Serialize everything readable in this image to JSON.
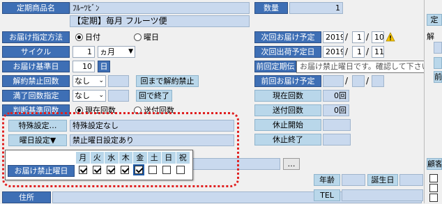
{
  "product": {
    "label": "定期商品名",
    "name_kana": "ﾌﾙｰﾂﾋﾞﾝ",
    "name": "【定期】毎月 フルーツ便"
  },
  "quantity": {
    "label": "数量",
    "value": "1"
  },
  "delivery_method": {
    "label": "お届け指定方法",
    "options": [
      "日付",
      "曜日"
    ],
    "selected": "日付"
  },
  "cycle": {
    "label": "サイクル",
    "value": "1",
    "unit": "ヵ月"
  },
  "base_day": {
    "label": "お届け基準日",
    "value": "10",
    "unit": "日"
  },
  "cancel_ban_count": {
    "label": "解約禁止回数",
    "select": "なし",
    "button": "回まで解約禁止"
  },
  "completion_count": {
    "label": "満了回数指定",
    "select": "なし",
    "button": "回で終了"
  },
  "judge_basis": {
    "label": "判断基準回数",
    "options": [
      "現在回数",
      "送付回数"
    ],
    "selected": "現在回数"
  },
  "special_settings": {
    "button": "特殊設定…",
    "value": "特殊設定なし"
  },
  "weekday_settings": {
    "button": "曜日設定▼",
    "value": "禁止曜日設定あり"
  },
  "forbidden_weekdays": {
    "label": "お届け禁止曜日",
    "days": [
      "月",
      "火",
      "水",
      "木",
      "金",
      "土",
      "日",
      "祝"
    ],
    "checked": [
      true,
      true,
      true,
      true,
      true,
      false,
      false,
      false
    ]
  },
  "next_delivery": {
    "label": "次回お届け予定",
    "year": "2019",
    "month": "1",
    "day": "10"
  },
  "next_shipping": {
    "label": "次回出荷予定日",
    "year": "2019",
    "month": "1",
    "day": "11"
  },
  "prev_regular": {
    "label": "前回定期伝"
  },
  "prev_delivery": {
    "label": "前回お届け予定"
  },
  "tooltip": "お届け禁止曜日です。確認して下さい。",
  "current_count": {
    "label": "現在回数",
    "value": "0回"
  },
  "sent_count": {
    "label": "送付回数",
    "value": "0回"
  },
  "pause_start": {
    "label": "休止開始"
  },
  "pause_end": {
    "label": "休止終了"
  },
  "customer": {
    "age_label": "年齢",
    "birth_label": "誕生日",
    "tel_label": "TEL",
    "address_label": "住所",
    "more_button": "…",
    "section_label": "顧客"
  },
  "right_edge": {
    "label1": "定",
    "label2": "解",
    "label3": "前"
  },
  "slash": "/",
  "colors": {
    "label_bg": "#3e6fb5",
    "readonly_bg": "#c9d9ee",
    "highlight": "#e02020",
    "warning": "#f5c400"
  }
}
